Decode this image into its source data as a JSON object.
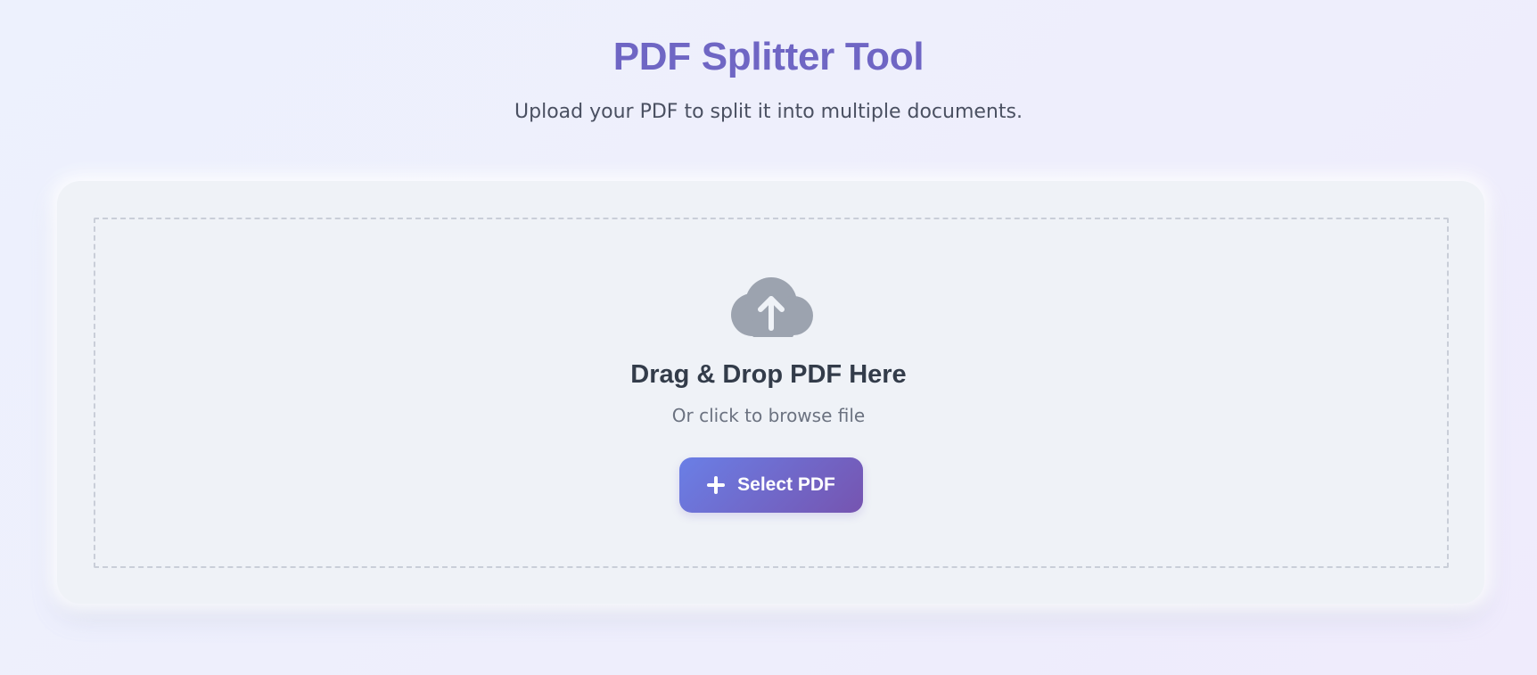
{
  "header": {
    "title": "PDF Splitter Tool",
    "subtitle": "Upload your PDF to split it into multiple documents."
  },
  "upload": {
    "icon": "cloud-upload-icon",
    "title": "Drag & Drop PDF Here",
    "hint": "Or click to browse file",
    "button_icon": "plus-icon",
    "button_label": "Select PDF"
  },
  "colors": {
    "title": "#6f66c4",
    "button_gradient_start": "#6a7fe6",
    "button_gradient_end": "#7654b0",
    "icon_gray": "#9ca3af"
  }
}
